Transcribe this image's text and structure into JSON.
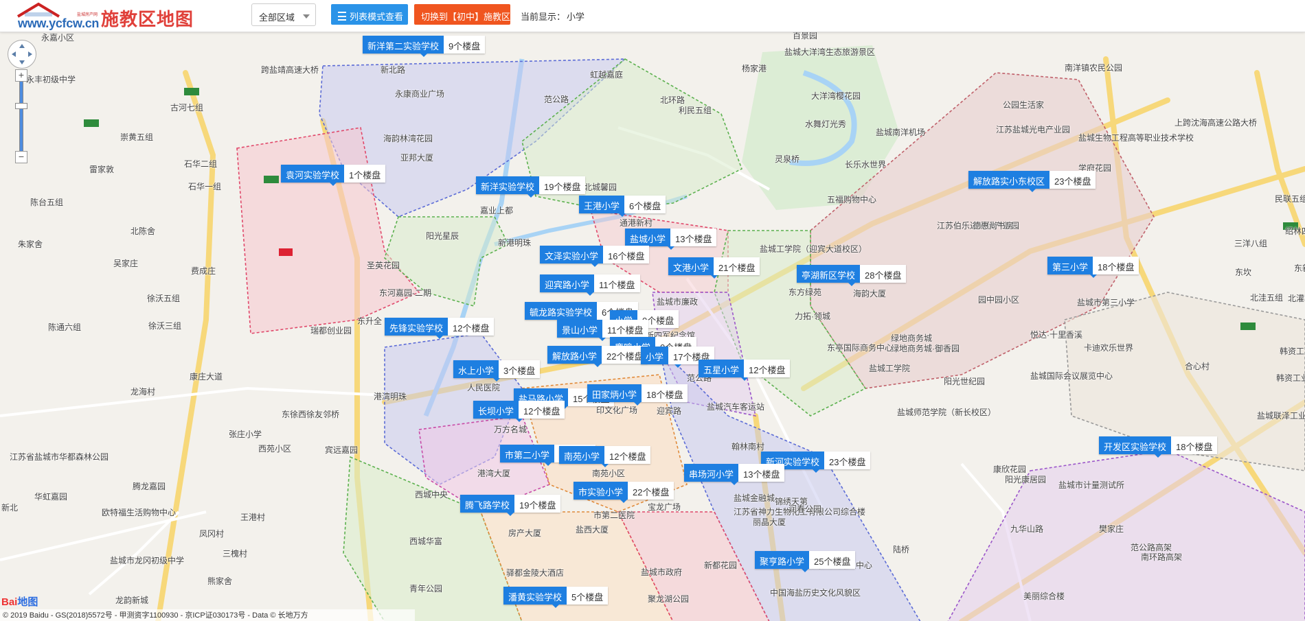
{
  "header": {
    "logo_text": "www.ycfcw.cn",
    "logo_sub": "盐城房产网",
    "title": "施教区地图",
    "region_select": "全部区域",
    "list_button": "列表模式查看",
    "switch_button": "切换到【初中】施教区",
    "current_label": "当前显示：",
    "current_value": "小学"
  },
  "colors": {
    "marker_blue": "#1e7fe1",
    "switch_orange": "#f0551f",
    "list_blue": "#2a93e8"
  },
  "markers": [
    {
      "name": "新洋第二实验学校",
      "count": "9个楼盘"
    },
    {
      "name": "袁河实验学校",
      "count": "1个楼盘"
    },
    {
      "name": "新洋实验学校",
      "count": "19个楼盘"
    },
    {
      "name": "王港小学",
      "count": "6个楼盘"
    },
    {
      "name": "盐城小学",
      "count": "13个楼盘"
    },
    {
      "name": "文泽实验小学",
      "count": "16个楼盘"
    },
    {
      "name": "文港小学",
      "count": "21个楼盘"
    },
    {
      "name": "亭湖新区学校",
      "count": "28个楼盘"
    },
    {
      "name": "解放路实小东校区",
      "count": "23个楼盘"
    },
    {
      "name": "第三小学",
      "count": "18个楼盘"
    },
    {
      "name": "迎宾路小学",
      "count": "11个楼盘"
    },
    {
      "name": "毓龙路实验学校",
      "count": "6个楼盘"
    },
    {
      "name": "小学",
      "count": "0个楼盘"
    },
    {
      "name": "先锋实验学校",
      "count": "12个楼盘"
    },
    {
      "name": "景山小学",
      "count": "11个楼盘"
    },
    {
      "name": "鹿鸣小学",
      "count": "0个楼盘"
    },
    {
      "name": "解放路小学",
      "count": "22个楼盘"
    },
    {
      "name": "小学",
      "count": "17个楼盘"
    },
    {
      "name": "五星小学",
      "count": "12个楼盘"
    },
    {
      "name": "水上小学",
      "count": "3个楼盘"
    },
    {
      "name": "盐马路小学",
      "count": "15个楼盘"
    },
    {
      "name": "田家炳小学",
      "count": "18个楼盘"
    },
    {
      "name": "长坝小学",
      "count": "12个楼盘"
    },
    {
      "name": "开发区实验学校",
      "count": "18个楼盘"
    },
    {
      "name": "市第二小学",
      "count": "4个楼盘"
    },
    {
      "name": "南苑小学",
      "count": "12个楼盘"
    },
    {
      "name": "新河实验学校",
      "count": "23个楼盘"
    },
    {
      "name": "串场河小学",
      "count": "13个楼盘"
    },
    {
      "name": "市实验小学",
      "count": "22个楼盘"
    },
    {
      "name": "腾飞路学校",
      "count": "19个楼盘"
    },
    {
      "name": "聚亨路小学",
      "count": "25个楼盘"
    },
    {
      "name": "潘黄实验学校",
      "count": "5个楼盘"
    }
  ],
  "map_labels": [
    "永嘉小区",
    "永丰初级中学",
    "跨盐靖高速大桥",
    "古河七组",
    "崇黄五组",
    "雷家敦",
    "石华二组",
    "石华一组",
    "陈台五组",
    "朱家舍",
    "北陈舍",
    "吴家庄",
    "费成庄",
    "徐沃五组",
    "陈通六组",
    "徐沃三组",
    "康庄大道",
    "龙海村",
    "东徐西徐友邻桥",
    "张庄小学",
    "西苑小区",
    "江苏省盐城市华都森林公园",
    "腾龙嘉园",
    "华虹嘉园",
    "欧特福生活购物中心",
    "新北",
    "王港村",
    "凤冈村",
    "三槐村",
    "盐城市龙冈初级中学",
    "熊家舍",
    "龙韵新城",
    "圣英花园",
    "东河嘉园-二期",
    "东升全",
    "瑞都创业园",
    "港湾明珠",
    "宾远嘉园",
    "西城中央",
    "西城华富",
    "青年公园",
    "新北路",
    "永康商业广场",
    "海韵林湾花园",
    "亚邦大厦",
    "北城馨园",
    "嘉业上都",
    "阳光星辰",
    "新港明珠",
    "虹越嘉庭",
    "范公路",
    "利民五组",
    "北环路",
    "杨家港",
    "百景园",
    "盐城大洋湾生态旅游景区",
    "大洋湾樱花园",
    "水舞灯光秀",
    "灵泉桥",
    "长乐水世界",
    "五福购物中心",
    "盐城南洋机场",
    "公园生活家",
    "江苏盐城光电产业园",
    "盐城生物工程高等职业技术学校",
    "学府花园",
    "南洋镇农民公园",
    "东方雅园",
    "上跨沈海高速公路大桥",
    "民联五组",
    "绍林四组",
    "三洋八组",
    "东坎",
    "东新七组",
    "北洼五组",
    "北灌村",
    "盐城市第三小学",
    "江苏伯乐达光伏产业园",
    "德惠尚书房",
    "盐城工学院（迎宾大道校区）",
    "东方绿苑",
    "力拓·领城",
    "海韵大厦",
    "园中园小区",
    "悦达·十里香溪",
    "卡迪欢乐世界",
    "韩资工业园3期",
    "韩资工业园邻里中心",
    "绿地商务城",
    "绿地商务城·御香园",
    "东亭国际商务中心",
    "盐城工学院",
    "盐城国际会议展览中心",
    "阳光世纪园",
    "合心村",
    "盐城师范学院（新长校区）",
    "盐城汽车客运站",
    "通港新村",
    "盐城市廉政",
    "新四军纪念馆",
    "范公路",
    "人民医院",
    "万方名城",
    "印文化广场",
    "迎宾路",
    "翰林南村",
    "港湾大厦",
    "南苑小区",
    "宝龙广场",
    "市第二医院",
    "丽晶大厦",
    "房产大厦",
    "盐西大厦",
    "驿都金陵大酒店",
    "盐城市政府",
    "新都花园",
    "聚龙湖公园",
    "中国海盐历史文化风貌区",
    "盐城金融城",
    "江苏省神力生物化工有限公司综合楼",
    "锦绣天第",
    "润春公园",
    "新高源工业邻里中心",
    "康欣花园",
    "阳光康居园",
    "盐城市计量测试所",
    "九华山路",
    "范公路高架",
    "南环路高架",
    "盐城联泽工业园",
    "陆桥",
    "樊家庄",
    "美丽综合楼"
  ],
  "map_controls": {
    "zoom_in": "+",
    "zoom_out": "−"
  },
  "attribution": {
    "baidu_logo_a": "Bai",
    "baidu_logo_b": "地图",
    "copyright": "© 2019 Baidu - GS(2018)5572号 - 甲测资字1100930 - 京ICP证030173号 - Data © 长地万方"
  }
}
